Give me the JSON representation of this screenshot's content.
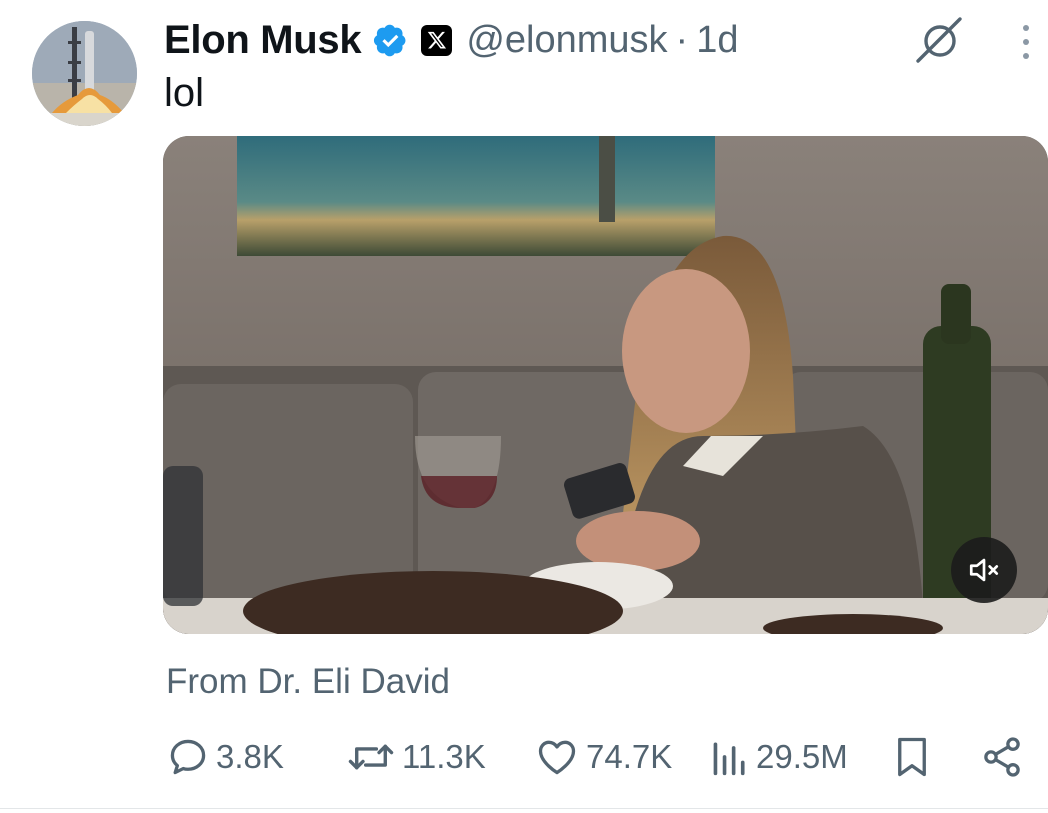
{
  "tweet": {
    "author_name": "Elon Musk",
    "handle": "@elonmusk",
    "separator": "·",
    "time_ago": "1d",
    "text": "lol",
    "source_label": "From Dr. Eli David"
  },
  "media": {
    "kind": "video",
    "muted": true
  },
  "metrics": {
    "replies": "3.8K",
    "reposts": "11.3K",
    "likes": "74.7K",
    "views": "29.5M"
  },
  "colors": {
    "verified": "#1d9bf0",
    "secondary_text": "#536471"
  }
}
